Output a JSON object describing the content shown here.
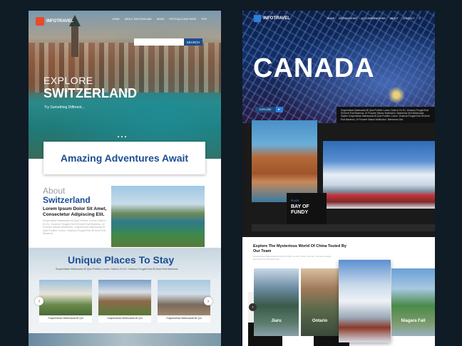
{
  "left": {
    "logo": "INFOTRAVEL",
    "nav": [
      "HOME",
      "ABOUT SWITZERLAND",
      "NEWS",
      "FESTIVALS AND FAIRS",
      "TIPS"
    ],
    "search_button": "SEARCH",
    "hero_line1": "EXPLORE",
    "hero_line2": "SWITZERLAND",
    "hero_sub": "Try Something Different...",
    "adventures": "Amazing Adventures Await",
    "about_label": "About",
    "about_title": "Switzerland",
    "about_heading": "Lorem Ipsum Dolor Sit Amet, Consectetur Adipiscing Elit.",
    "about_text": "Suspendisse Malesuada Mi Quis Porttitor Luctus. Nulla In Ex Eu. Vivamus Feugiat Erat Sit Amet Erat Maximus, Ut Posuere Massa Vestibulum. Suspendisse Malesuada Mi Quis Porttitor Luctus. Vivamus Feugiat Erat Sit Amet Erat Maximus.",
    "stay_title": "Unique Places To Stay",
    "stay_sub": "Suspendisse Malesuada Mi Quis Porttitor Luctus. Nulla In Ex Eu. Vivamus Feugiat Erat Sit Amet Erat Maximus",
    "cards": [
      "Suspendisse Malesuada Mi Qui",
      "Suspendisse Malesuada Mi Qui",
      "Suspendisse Malesuada Mi Qui"
    ],
    "arrow_prev": "‹",
    "arrow_next": "›"
  },
  "right": {
    "logo": "INFOTRAVEL",
    "nav": [
      "HOME",
      "DESTINATIONS",
      "ACCOMMODATIONS",
      "ABOUT",
      "CONTACT"
    ],
    "hero_title": "CANADA",
    "explore_button": "EXPLORE",
    "explore_arrow": "▸",
    "hero_text": "Suspendisse Malesuada Mi Quis Porttitor Luctus. Nulla In Ex Eu. Vivamus Feugiat Erat Sit Amet Erat Maximus, Ut Posuere Massa Vestibulum. Maecenas Sed Malesuada Sapien Suspendisse Malesuada Mi Quis Porttitor Luctus. Vivamus Feugiat Erat Sit Amet Erat Maximus, Ut Posuere Massa Vestibulum. Maecenas Sed.",
    "read_more": "READ MORE",
    "place_label": "PLACE",
    "place_name": "BAY OF FUNDY",
    "china_title": "Explore The Mysterious World Of China Tested By Our Team",
    "china_text": "Suspendisse Malesuada Mi Quis Porttitor Luctus. Nulla In Ex Eu. Vivamus Feugiat Erat Sit Amet Erat Maximus.",
    "cards": [
      "Jiaru",
      "Ontario",
      "",
      "Niagara Fall"
    ],
    "arrow_prev": "‹"
  },
  "colors": {
    "page_bg": "#0f1b25",
    "accent_blue": "#1b4e92",
    "right_accent": "#2d7fd9"
  }
}
